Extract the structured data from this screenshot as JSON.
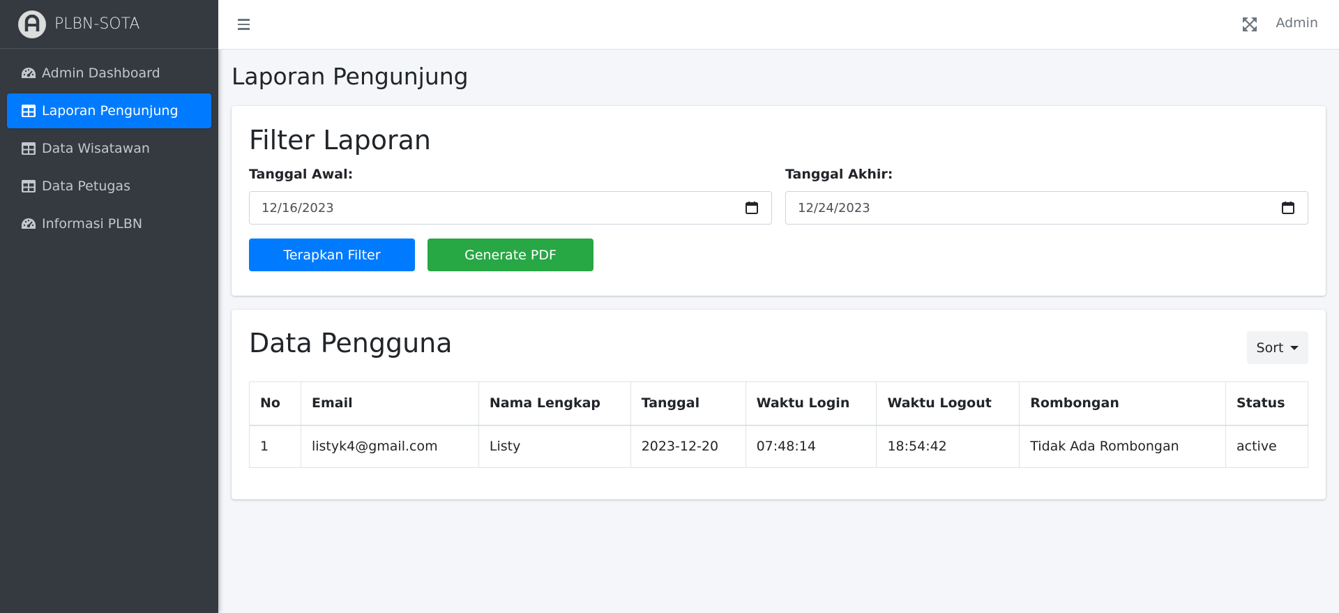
{
  "brand": {
    "name": "PLBN-SOTA"
  },
  "sidebar": {
    "items": [
      {
        "label": "Admin Dashboard",
        "icon": "tachometer-icon",
        "active": false
      },
      {
        "label": "Laporan Pengunjung",
        "icon": "table-icon",
        "active": true
      },
      {
        "label": "Data Wisatawan",
        "icon": "table-icon",
        "active": false
      },
      {
        "label": "Data Petugas",
        "icon": "table-icon",
        "active": false
      },
      {
        "label": "Informasi PLBN",
        "icon": "tachometer-icon",
        "active": false
      }
    ]
  },
  "topbar": {
    "user_label": "Admin",
    "menu_icon": "hamburger-icon",
    "fullscreen_icon": "expand-icon"
  },
  "page": {
    "title": "Laporan Pengunjung"
  },
  "filter": {
    "heading": "Filter Laporan",
    "start_label": "Tanggal Awal:",
    "start_value": "12/16/2023",
    "end_label": "Tanggal Akhir:",
    "end_value": "12/24/2023",
    "apply_label": "Terapkan Filter",
    "pdf_label": "Generate PDF"
  },
  "data": {
    "heading": "Data Pengguna",
    "sort_label": "Sort",
    "columns": [
      "No",
      "Email",
      "Nama Lengkap",
      "Tanggal",
      "Waktu Login",
      "Waktu Logout",
      "Rombongan",
      "Status"
    ],
    "rows": [
      [
        "1",
        "listyk4@gmail.com",
        "Listy",
        "2023-12-20",
        "07:48:14",
        "18:54:42",
        "Tidak Ada Rombongan",
        "active"
      ]
    ]
  },
  "colors": {
    "sidebar_bg": "#343a40",
    "active_nav": "#007bff",
    "primary": "#007bff",
    "success": "#28a745",
    "page_bg": "#f4f6f9"
  }
}
